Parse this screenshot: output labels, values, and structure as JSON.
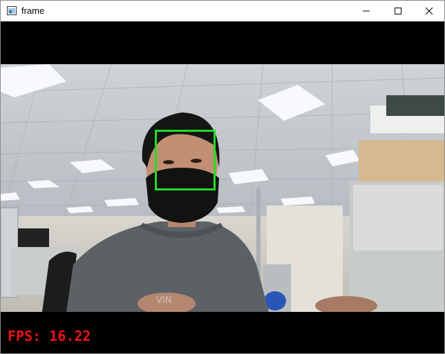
{
  "window": {
    "title": "frame",
    "controls": {
      "minimize": "minimize-icon",
      "maximize": "maximize-icon",
      "close": "close-icon"
    }
  },
  "overlay": {
    "fps_text": "FPS: 16.22",
    "fps_color": "#ee1111",
    "face_box_color": "#22dd22"
  },
  "frame": {
    "background": "#000000",
    "scene": "webcam-feed-office-person-mask-icon"
  }
}
